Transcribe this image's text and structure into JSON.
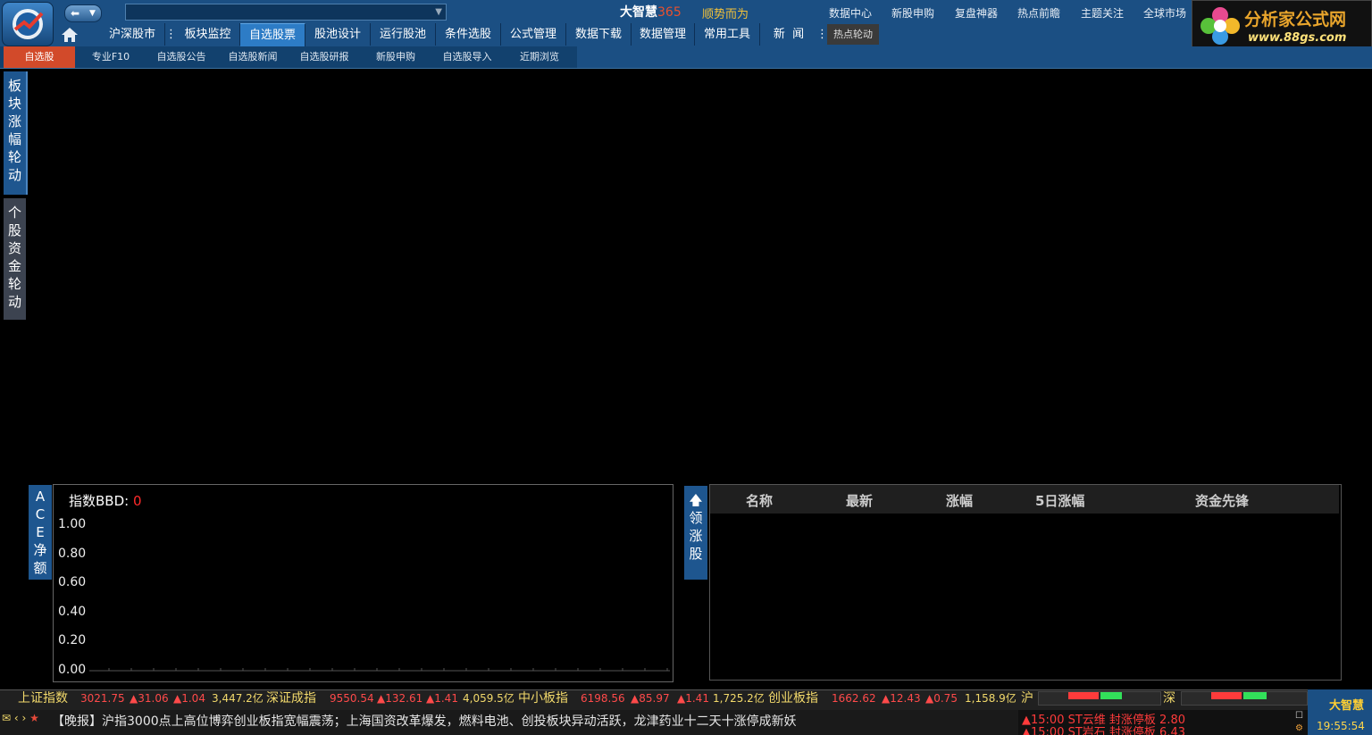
{
  "app": {
    "brand_name": "大智慧",
    "brand_num": "365",
    "slogan": "顺势而为",
    "top_links": [
      "数据中心",
      "新股申购",
      "复盘神器",
      "热点前瞻",
      "主题关注",
      "全球市场"
    ],
    "watermark_title": "分析家公式网",
    "watermark_url": "www.88gs.com"
  },
  "nav": {
    "items": [
      "沪深股市",
      "板块监控",
      "自选股票",
      "股池设计",
      "运行股池",
      "条件选股",
      "公式管理",
      "数据下载",
      "数据管理",
      "常用工具",
      "新  闻"
    ],
    "active": "自选股票",
    "hot_rotation": "热点轮动"
  },
  "subnav": {
    "items": [
      "自选股",
      "专业F10",
      "自选股公告",
      "自选股新闻",
      "自选股研报",
      "新股申购",
      "自选股导入",
      "近期浏览"
    ],
    "active": "自选股"
  },
  "side_tabs": {
    "sector_rotation": [
      "板",
      "块",
      "涨",
      "幅",
      "轮",
      "动"
    ],
    "stock_fund_rotation": [
      "个",
      "股",
      "资",
      "金",
      "轮",
      "动"
    ]
  },
  "ace_panel": {
    "label_chars": [
      "A",
      "C",
      "E",
      "净",
      "额"
    ],
    "title": "指数BBD:",
    "value": "0"
  },
  "chart_data": {
    "type": "bar",
    "title": "指数BBD:",
    "xlabel": "",
    "ylabel": "",
    "ylim": [
      0,
      1
    ],
    "y_ticks": [
      "1.00",
      "0.80",
      "0.60",
      "0.40",
      "0.20",
      "0.00"
    ],
    "categories": [],
    "values": []
  },
  "lead_panel": {
    "label_chars": [
      "领",
      "涨",
      "股"
    ],
    "columns": [
      "名称",
      "最新",
      "涨幅",
      "5日涨幅",
      "资金先锋"
    ],
    "rows": []
  },
  "ticker": {
    "sh": {
      "name": "上证指数",
      "price": "3021.75",
      "chg": "▲31.06",
      "pct": "▲1.04",
      "amount": "3,447.2亿"
    },
    "sz": {
      "name": "深证成指",
      "price": "9550.54",
      "chg": "▲132.61",
      "pct": "▲1.41",
      "amount": "4,059.5亿"
    },
    "zx": {
      "name": "中小板指",
      "price": "6198.56",
      "chg": "▲85.97",
      "pct": "▲1.41",
      "amount": "1,725.2亿"
    },
    "cy": {
      "name": "创业板指",
      "price": "1662.62",
      "chg": "▲12.43",
      "pct": "▲0.75",
      "amount": "1,158.9亿"
    },
    "hu_label": "沪",
    "shen_label": "深"
  },
  "news": {
    "text": "【晚报】沪指3000点上高位博弈创业板指宽幅震荡；上海国资改革爆发，燃料电池、创投板块异动活跃，龙津药业十二天十涨停成新妖"
  },
  "alerts": [
    "▲15:00 ST云维   封涨停板 2.80",
    "▲15:00 ST岩石   封涨停板 6.43"
  ],
  "status": {
    "time": "19:55:54",
    "mini_logo": "大智慧"
  },
  "colors": {
    "accent_blue": "#1b4f83",
    "active_tab": "#2d7cc6",
    "active_sub": "#d24a2a",
    "up_red": "#ff4a4a",
    "amount_yellow": "#f2d96b"
  }
}
